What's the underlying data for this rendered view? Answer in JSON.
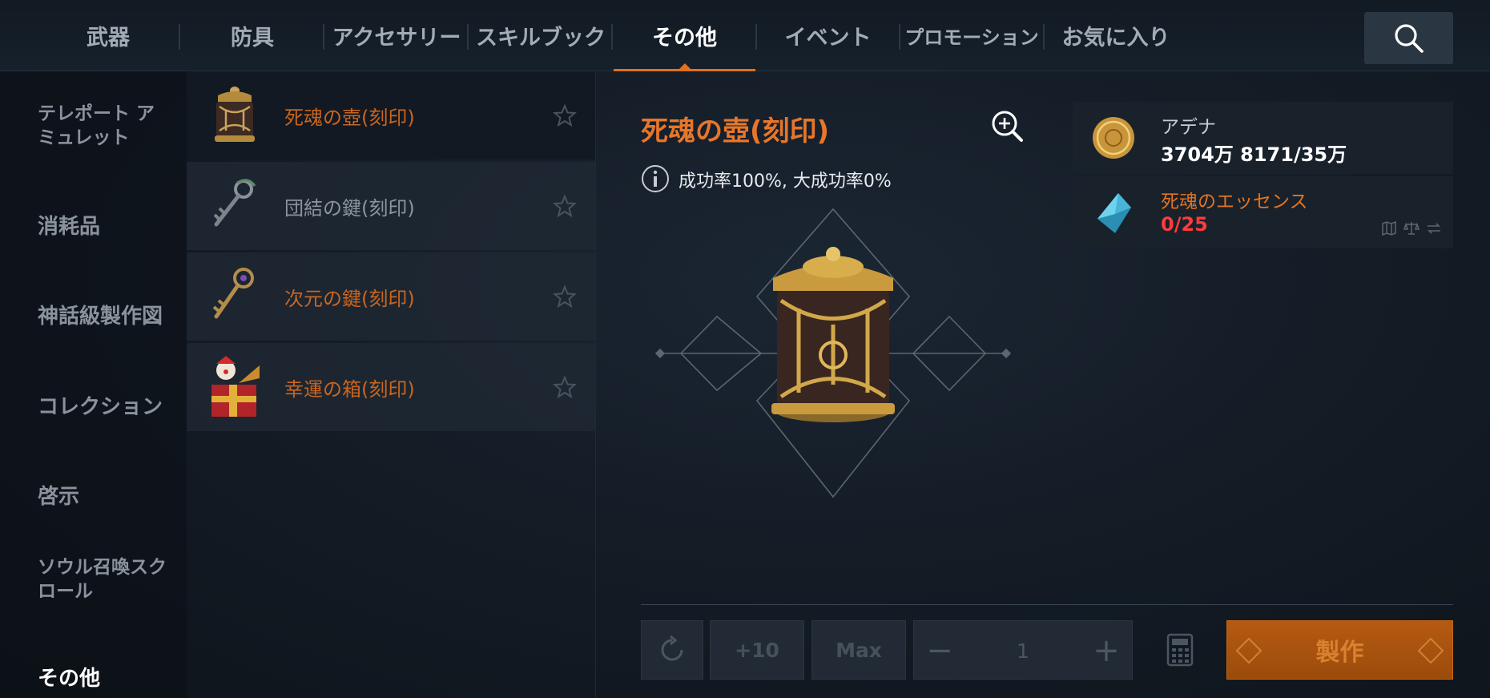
{
  "tabs": [
    {
      "label": "武器",
      "active": false
    },
    {
      "label": "防具",
      "active": false
    },
    {
      "label": "アクセサリー",
      "active": false
    },
    {
      "label": "スキルブック",
      "active": false
    },
    {
      "label": "その他",
      "active": true
    },
    {
      "label": "イベント",
      "active": false
    },
    {
      "label": "プロモーション",
      "active": false
    },
    {
      "label": "お気に入り",
      "active": false
    }
  ],
  "search": {
    "icon": "search-icon"
  },
  "categories": [
    {
      "label": "テレポート アミュレット",
      "line1": "テレポート ア",
      "line2": "ミュレット",
      "active": false
    },
    {
      "label": "消耗品",
      "active": false
    },
    {
      "label": "神話級製作図",
      "active": false
    },
    {
      "label": "コレクション",
      "active": false
    },
    {
      "label": "啓示",
      "active": false
    },
    {
      "label": "ソウル召喚スクロール",
      "line1": "ソウル召喚スク",
      "line2": "ロール",
      "active": false
    },
    {
      "label": "その他",
      "active": true
    }
  ],
  "items": [
    {
      "name": "死魂の壺(刻印)",
      "color": "orange",
      "selected": true,
      "icon": "urn-icon"
    },
    {
      "name": "団結の鍵(刻印)",
      "color": "gray",
      "selected": false,
      "icon": "key-icon"
    },
    {
      "name": "次元の鍵(刻印)",
      "color": "orange",
      "selected": false,
      "icon": "ornate-key-icon"
    },
    {
      "name": "幸運の箱(刻印)",
      "color": "orange",
      "selected": false,
      "icon": "jack-in-box-icon"
    }
  ],
  "detail": {
    "title": "死魂の壺(刻印)",
    "rate": "成功率100%, 大成功率0%"
  },
  "materials": [
    {
      "name": "アデナ",
      "value": "3704万 8171/35万",
      "icon": "adena-coin-icon",
      "value_color": "#ffffff"
    },
    {
      "name": "死魂のエッセンス",
      "value": "0/25",
      "icon": "essence-crystal-icon",
      "value_color": "#ff3b3b"
    }
  ],
  "controls": {
    "plus10": "+10",
    "max": "Max",
    "minus": "−",
    "plus": "+",
    "quantity": "1",
    "craft": "製作"
  },
  "colors": {
    "accent": "#e3701e",
    "title_orange": "#e7762a",
    "error_red": "#ff3b3b"
  }
}
